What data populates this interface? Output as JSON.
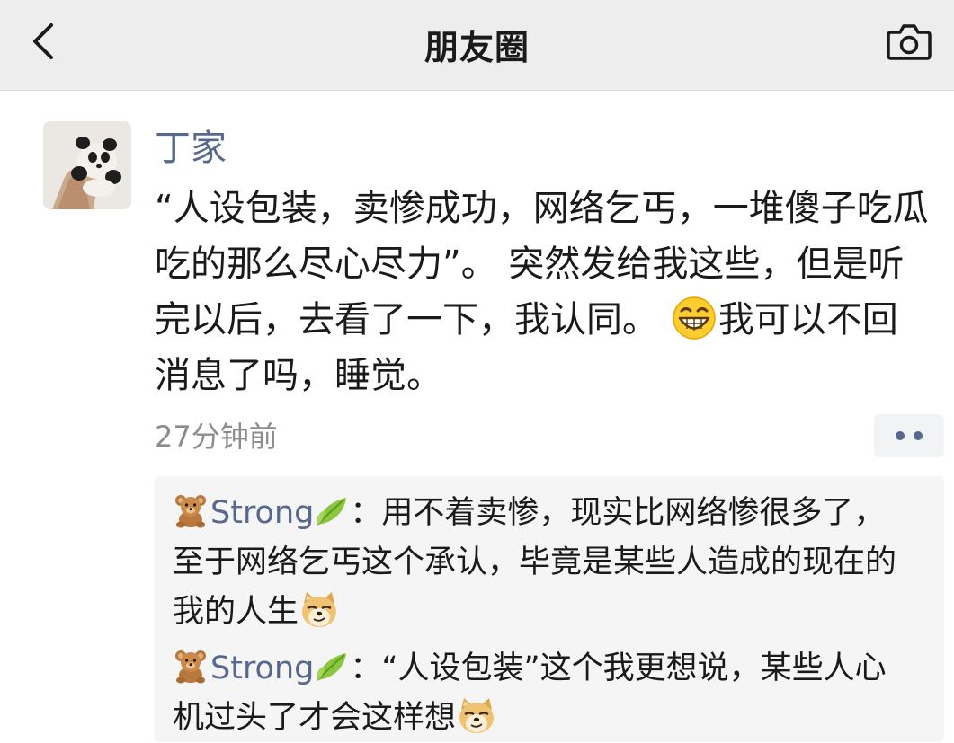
{
  "header": {
    "title": "朋友圈",
    "back_icon": "chevron-left-icon",
    "camera_icon": "camera-icon",
    "background": "#ededed"
  },
  "post": {
    "author": "丁家",
    "author_color": "#57688f",
    "avatar_icon": "panda-avatar",
    "text": {
      "line1": "“人设包装，卖惨成功，网络乞丐，一堆傻子吃瓜",
      "line2": "吃的那么尽心尽力”。 突然发给我这些，但是听",
      "line3_a": "完以后，去看了一下，我认同。 ",
      "line3_b": "我可以不回",
      "line4": "消息了吗，睡觉。"
    },
    "emoji": "grin-emoji",
    "timestamp": "27分钟前",
    "more_icon": "more-dots-icon"
  },
  "comments": [
    {
      "user": "Strong",
      "user_icons": [
        "bear-emoji",
        "leaf-emoji"
      ],
      "line1": "：用不着卖惨，现实比网络惨很多了，",
      "line2": "至于网络乞丐这个承认，毕竟是某些人造成的现在的",
      "line3": "我的人生",
      "end_emoji": "doge-emoji"
    },
    {
      "user": "Strong",
      "user_icons": [
        "bear-emoji",
        "leaf-emoji"
      ],
      "line1": "：“人设包装”这个我更想说，某些人心",
      "line2": "机过头了才会这样想",
      "end_emoji": "doge-emoji"
    }
  ]
}
